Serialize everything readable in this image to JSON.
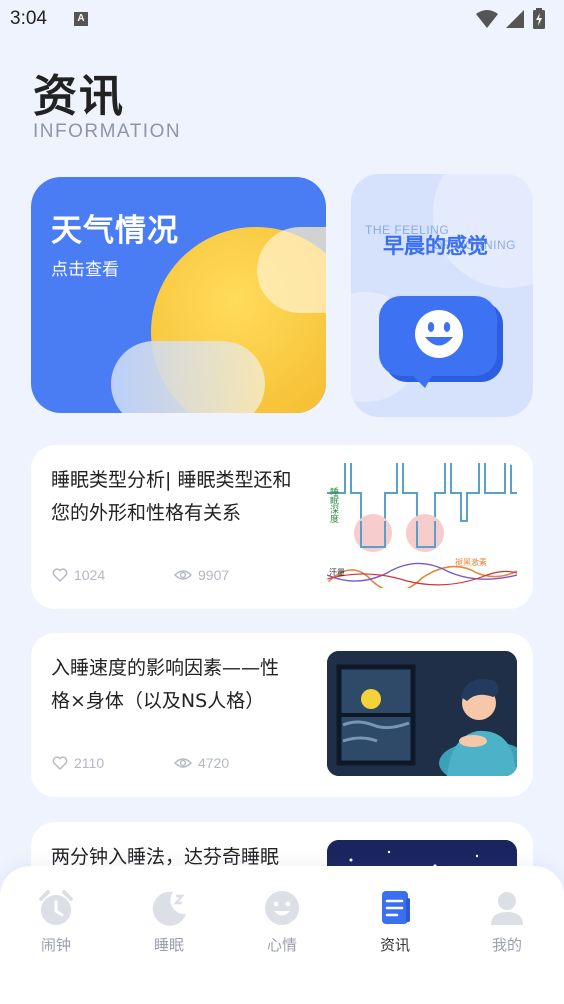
{
  "status_bar": {
    "time": "3:04",
    "notification_badge": "A"
  },
  "header": {
    "title": "资讯",
    "subtitle": "INFORMATION"
  },
  "feature_cards": {
    "weather": {
      "title": "天气情况",
      "subtitle": "点击查看"
    },
    "morning": {
      "title": "早晨的感觉",
      "background_text": [
        "THE FEELING",
        "OF MORNING"
      ]
    }
  },
  "articles": [
    {
      "title": "睡眠类型分析| 睡眠类型还和您的外形和性格有关系",
      "likes": "1024",
      "views": "9907",
      "image_labels": {
        "sleep_depth": "睡眠深度",
        "melatonin": "褪黑激素",
        "sweat": "汗量"
      }
    },
    {
      "title": "入睡速度的影响因素——性格×身体（以及NS人格）",
      "likes": "2110",
      "views": "4720"
    },
    {
      "title": "两分钟入睡法，达芬奇睡眠法",
      "likes": "",
      "views": ""
    }
  ],
  "bottom_nav": {
    "items": [
      {
        "label": "闹钟",
        "icon": "alarm-clock-icon"
      },
      {
        "label": "睡眠",
        "icon": "moon-icon"
      },
      {
        "label": "心情",
        "icon": "smiley-icon"
      },
      {
        "label": "资讯",
        "icon": "document-icon"
      },
      {
        "label": "我的",
        "icon": "person-icon"
      }
    ],
    "active": "资讯"
  },
  "colors": {
    "background": "#eef3fe",
    "accent_blue": "#3a6ff0",
    "weather_card": "#4a7cf4",
    "sun_yellow": "#f7c43a",
    "muted_text": "#b4b8c2",
    "nav_inactive_icon": "#dcdfe6"
  }
}
